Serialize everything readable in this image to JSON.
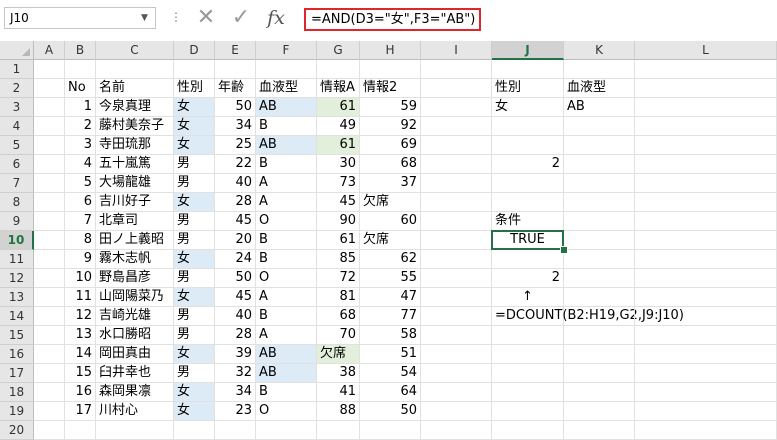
{
  "formula_bar": {
    "name_box": "J10",
    "formula": "=AND(D3=\"女\",F3=\"AB\")",
    "cancel_icon": "x-icon",
    "enter_icon": "check-icon",
    "function_icon": "fx"
  },
  "columns": [
    "A",
    "B",
    "C",
    "D",
    "E",
    "F",
    "G",
    "H",
    "I",
    "J",
    "K",
    "L"
  ],
  "selected_column": "J",
  "selected_row": "10",
  "rows": [
    "1",
    "2",
    "3",
    "4",
    "5",
    "6",
    "7",
    "8",
    "9",
    "10",
    "11",
    "12",
    "13",
    "14",
    "15",
    "16",
    "17",
    "18",
    "19",
    "20"
  ],
  "table": {
    "headers": {
      "no": "No",
      "name": "名前",
      "gender": "性別",
      "age": "年齢",
      "blood": "血液型",
      "infoA": "情報A",
      "info2": "情報2"
    },
    "records": [
      {
        "no": "1",
        "name": "今泉真理",
        "gender": "女",
        "age": "50",
        "blood": "AB",
        "infoA": "61",
        "info2": "59"
      },
      {
        "no": "2",
        "name": "藤村美奈子",
        "gender": "女",
        "age": "34",
        "blood": "B",
        "infoA": "49",
        "info2": "92"
      },
      {
        "no": "3",
        "name": "寺田琉那",
        "gender": "女",
        "age": "25",
        "blood": "AB",
        "infoA": "61",
        "info2": "69"
      },
      {
        "no": "4",
        "name": "五十嵐篤",
        "gender": "男",
        "age": "22",
        "blood": "B",
        "infoA": "30",
        "info2": "68"
      },
      {
        "no": "5",
        "name": "大場龍雄",
        "gender": "男",
        "age": "40",
        "blood": "A",
        "infoA": "73",
        "info2": "37"
      },
      {
        "no": "6",
        "name": "吉川好子",
        "gender": "女",
        "age": "28",
        "blood": "A",
        "infoA": "45",
        "info2": "欠席"
      },
      {
        "no": "7",
        "name": "北章司",
        "gender": "男",
        "age": "45",
        "blood": "O",
        "infoA": "90",
        "info2": "60"
      },
      {
        "no": "8",
        "name": "田ノ上義昭",
        "gender": "男",
        "age": "20",
        "blood": "B",
        "infoA": "61",
        "info2": "欠席"
      },
      {
        "no": "9",
        "name": "霧木志帆",
        "gender": "女",
        "age": "24",
        "blood": "B",
        "infoA": "85",
        "info2": "62"
      },
      {
        "no": "10",
        "name": "野島昌彦",
        "gender": "男",
        "age": "50",
        "blood": "O",
        "infoA": "72",
        "info2": "55"
      },
      {
        "no": "11",
        "name": "山岡陽菜乃",
        "gender": "女",
        "age": "45",
        "blood": "A",
        "infoA": "81",
        "info2": "47"
      },
      {
        "no": "12",
        "name": "吉崎光雄",
        "gender": "男",
        "age": "40",
        "blood": "B",
        "infoA": "68",
        "info2": "77"
      },
      {
        "no": "13",
        "name": "水口勝昭",
        "gender": "男",
        "age": "28",
        "blood": "A",
        "infoA": "70",
        "info2": "58"
      },
      {
        "no": "14",
        "name": "岡田真由",
        "gender": "女",
        "age": "39",
        "blood": "AB",
        "infoA": "欠席",
        "info2": "51"
      },
      {
        "no": "15",
        "name": "臼井幸也",
        "gender": "男",
        "age": "32",
        "blood": "AB",
        "infoA": "38",
        "info2": "54"
      },
      {
        "no": "16",
        "name": "森岡果凛",
        "gender": "女",
        "age": "34",
        "blood": "B",
        "infoA": "41",
        "info2": "64"
      },
      {
        "no": "17",
        "name": "川村心",
        "gender": "女",
        "age": "23",
        "blood": "O",
        "infoA": "88",
        "info2": "50"
      }
    ]
  },
  "side": {
    "criteria_header_gender": "性別",
    "criteria_header_blood": "血液型",
    "criteria_gender": "女",
    "criteria_blood": "AB",
    "result1": "2",
    "condition_label": "条件",
    "condition_value": "TRUE",
    "result2": "2",
    "arrow": "↑",
    "dcount_formula": "=DCOUNT(B2:H19,G2,J9:J10)"
  },
  "colors": {
    "accent": "#217346",
    "highlight_blue": "#ddebf7",
    "highlight_green": "#e2efda",
    "formula_border": "#e0262b"
  }
}
